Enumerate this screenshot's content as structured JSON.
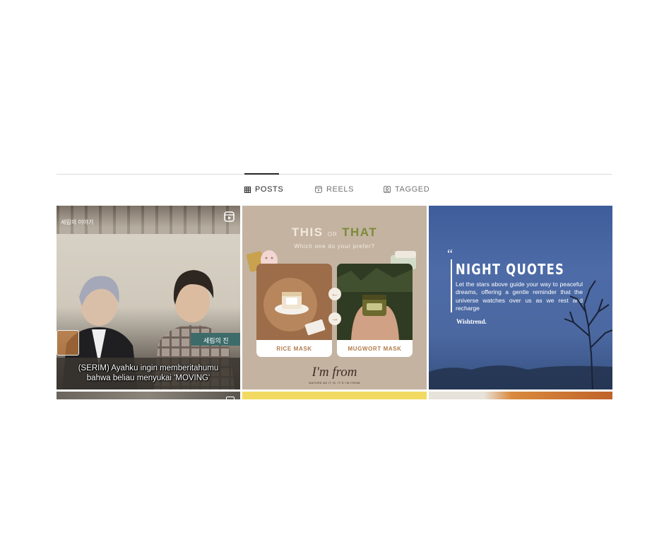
{
  "tabs": [
    {
      "label": "POSTS",
      "icon": "grid-icon",
      "active": true
    },
    {
      "label": "REELS",
      "icon": "reels-icon",
      "active": false
    },
    {
      "label": "TAGGED",
      "icon": "tagged-icon",
      "active": false
    }
  ],
  "posts": [
    {
      "type": "reel",
      "subtitle_line1": "(SERIM) Ayahku ingin memberitahumu",
      "subtitle_line2": "bahwa beliau menyukai 'MOVING'",
      "sign_top": "세림의 이야기",
      "sign_side": "세림의 진"
    },
    {
      "type": "image",
      "this": "THIS",
      "or": "OR",
      "that": "THAT",
      "prefer": "Which one do your prefer?",
      "left_label": "RICE MASK",
      "right_label": "MUGWORT MASK",
      "brand": "I'm from",
      "tagline": "NATURE AS IT IS, IT'S I'M FROM"
    },
    {
      "type": "image",
      "title": "NIGHT QUOTES",
      "body": "Let the stars above guide your way to peaceful dreams, offering a gentle reminder that the universe watches over us as we rest and recharge",
      "brand": "Wishtrend."
    }
  ],
  "colors": {
    "active_tab": "#262626",
    "inactive_tab": "#737373",
    "divider": "#dbdbdb"
  }
}
